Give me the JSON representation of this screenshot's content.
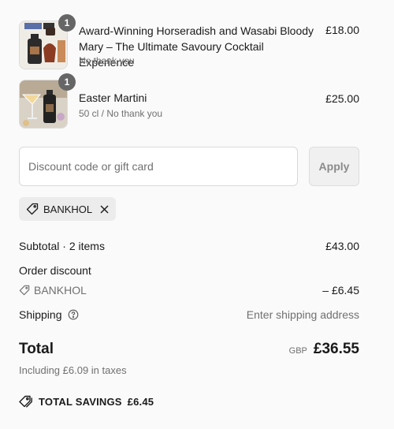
{
  "items": [
    {
      "title": "Award-Winning Horseradish and Wasabi Bloody Mary – The Ultimate Savoury Cocktail Experience",
      "subtitle": "No thank you",
      "price": "£18.00",
      "quantity": "1"
    },
    {
      "title": "Easter Martini",
      "subtitle": "50 cl / No thank you",
      "price": "£25.00",
      "quantity": "1"
    }
  ],
  "discount": {
    "placeholder": "Discount code or gift card",
    "apply_label": "Apply",
    "applied_code": "BANKHOL"
  },
  "summary": {
    "subtotal_label": "Subtotal · 2 items",
    "subtotal_value": "£43.00",
    "order_discount_label": "Order discount",
    "discount_code": "BANKHOL",
    "discount_value": "– £6.45",
    "shipping_label": "Shipping",
    "shipping_value": "Enter shipping address",
    "total_label": "Total",
    "currency": "GBP",
    "total_value": "£36.55",
    "taxes_text": "Including £6.09 in taxes",
    "savings_label": "TOTAL SAVINGS",
    "savings_value": "£6.45"
  },
  "colors": {
    "text": "#1a1a1a",
    "muted": "#707070",
    "badge": "#666666"
  }
}
